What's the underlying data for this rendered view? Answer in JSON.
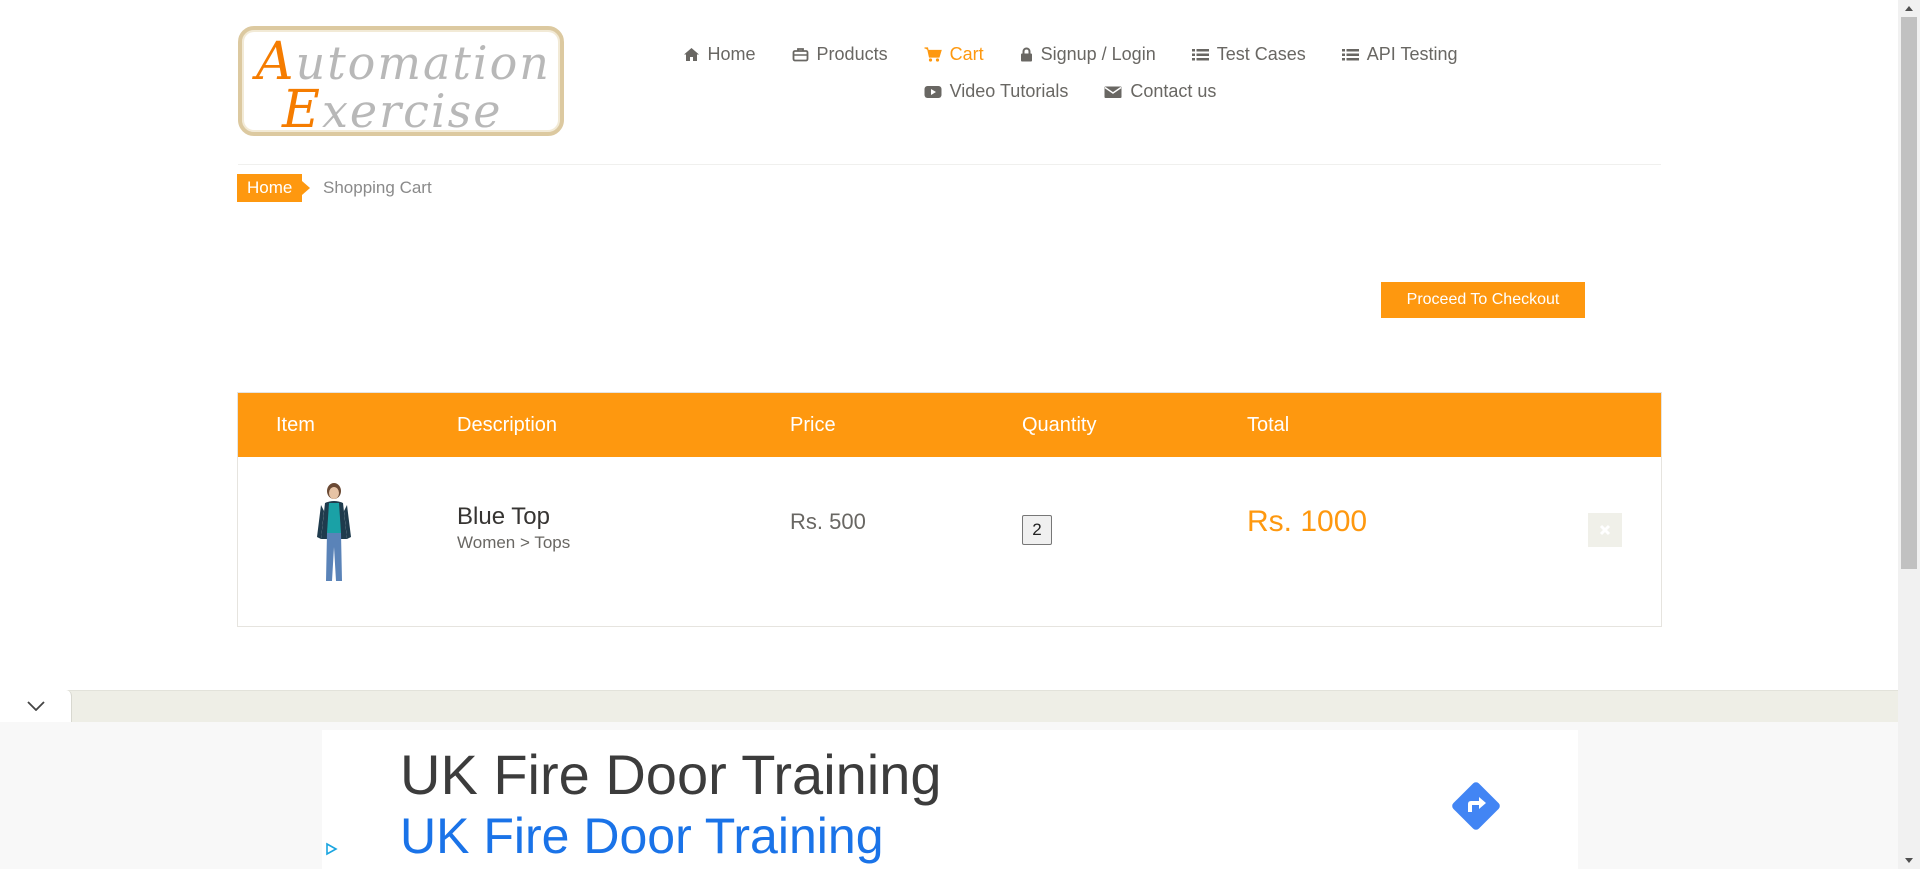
{
  "logo": {
    "line1_cap": "A",
    "line1_rest": "utomation",
    "line2_cap": "E",
    "line2_rest": "xercise"
  },
  "nav": {
    "row1": [
      {
        "label": "Home",
        "icon": "home-icon",
        "active": false
      },
      {
        "label": "Products",
        "icon": "briefcase-icon",
        "active": false
      },
      {
        "label": "Cart",
        "icon": "cart-icon",
        "active": true
      },
      {
        "label": "Signup / Login",
        "icon": "lock-icon",
        "active": false
      },
      {
        "label": "Test Cases",
        "icon": "list-icon",
        "active": false
      },
      {
        "label": "API Testing",
        "icon": "list-icon",
        "active": false
      }
    ],
    "row2": [
      {
        "label": "Video Tutorials",
        "icon": "youtube-play-icon",
        "active": false
      },
      {
        "label": "Contact us",
        "icon": "envelope-icon",
        "active": false
      }
    ]
  },
  "breadcrumb": {
    "home": "Home",
    "current": "Shopping Cart"
  },
  "checkout": {
    "label": "Proceed To Checkout"
  },
  "cart_table": {
    "headers": [
      "Item",
      "Description",
      "Price",
      "Quantity",
      "Total"
    ],
    "rows": [
      {
        "name": "Blue Top",
        "category": "Women > Tops",
        "price": "Rs. 500",
        "quantity": "2",
        "total": "Rs. 1000"
      }
    ]
  },
  "ad": {
    "title": "UK Fire Door Training",
    "subtitle": "UK Fire Door Training"
  },
  "colors": {
    "accent": "#fe980f",
    "text": "#696763",
    "link_blue": "#1a73e8",
    "ad_arrow": "#4285f4"
  }
}
